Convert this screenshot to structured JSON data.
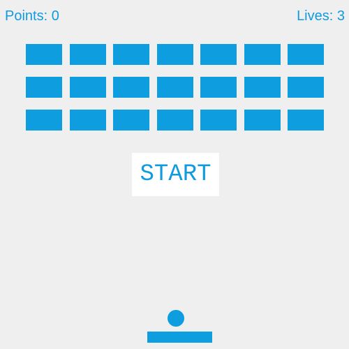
{
  "hud": {
    "points_label": "Points: 0",
    "lives_label": "Lives: 3"
  },
  "game": {
    "start_label": "START",
    "brick_rows": 3,
    "brick_columns": 7
  },
  "colors": {
    "accent": "#0e9ddf",
    "background": "#efefef",
    "button_background": "#ffffff"
  }
}
